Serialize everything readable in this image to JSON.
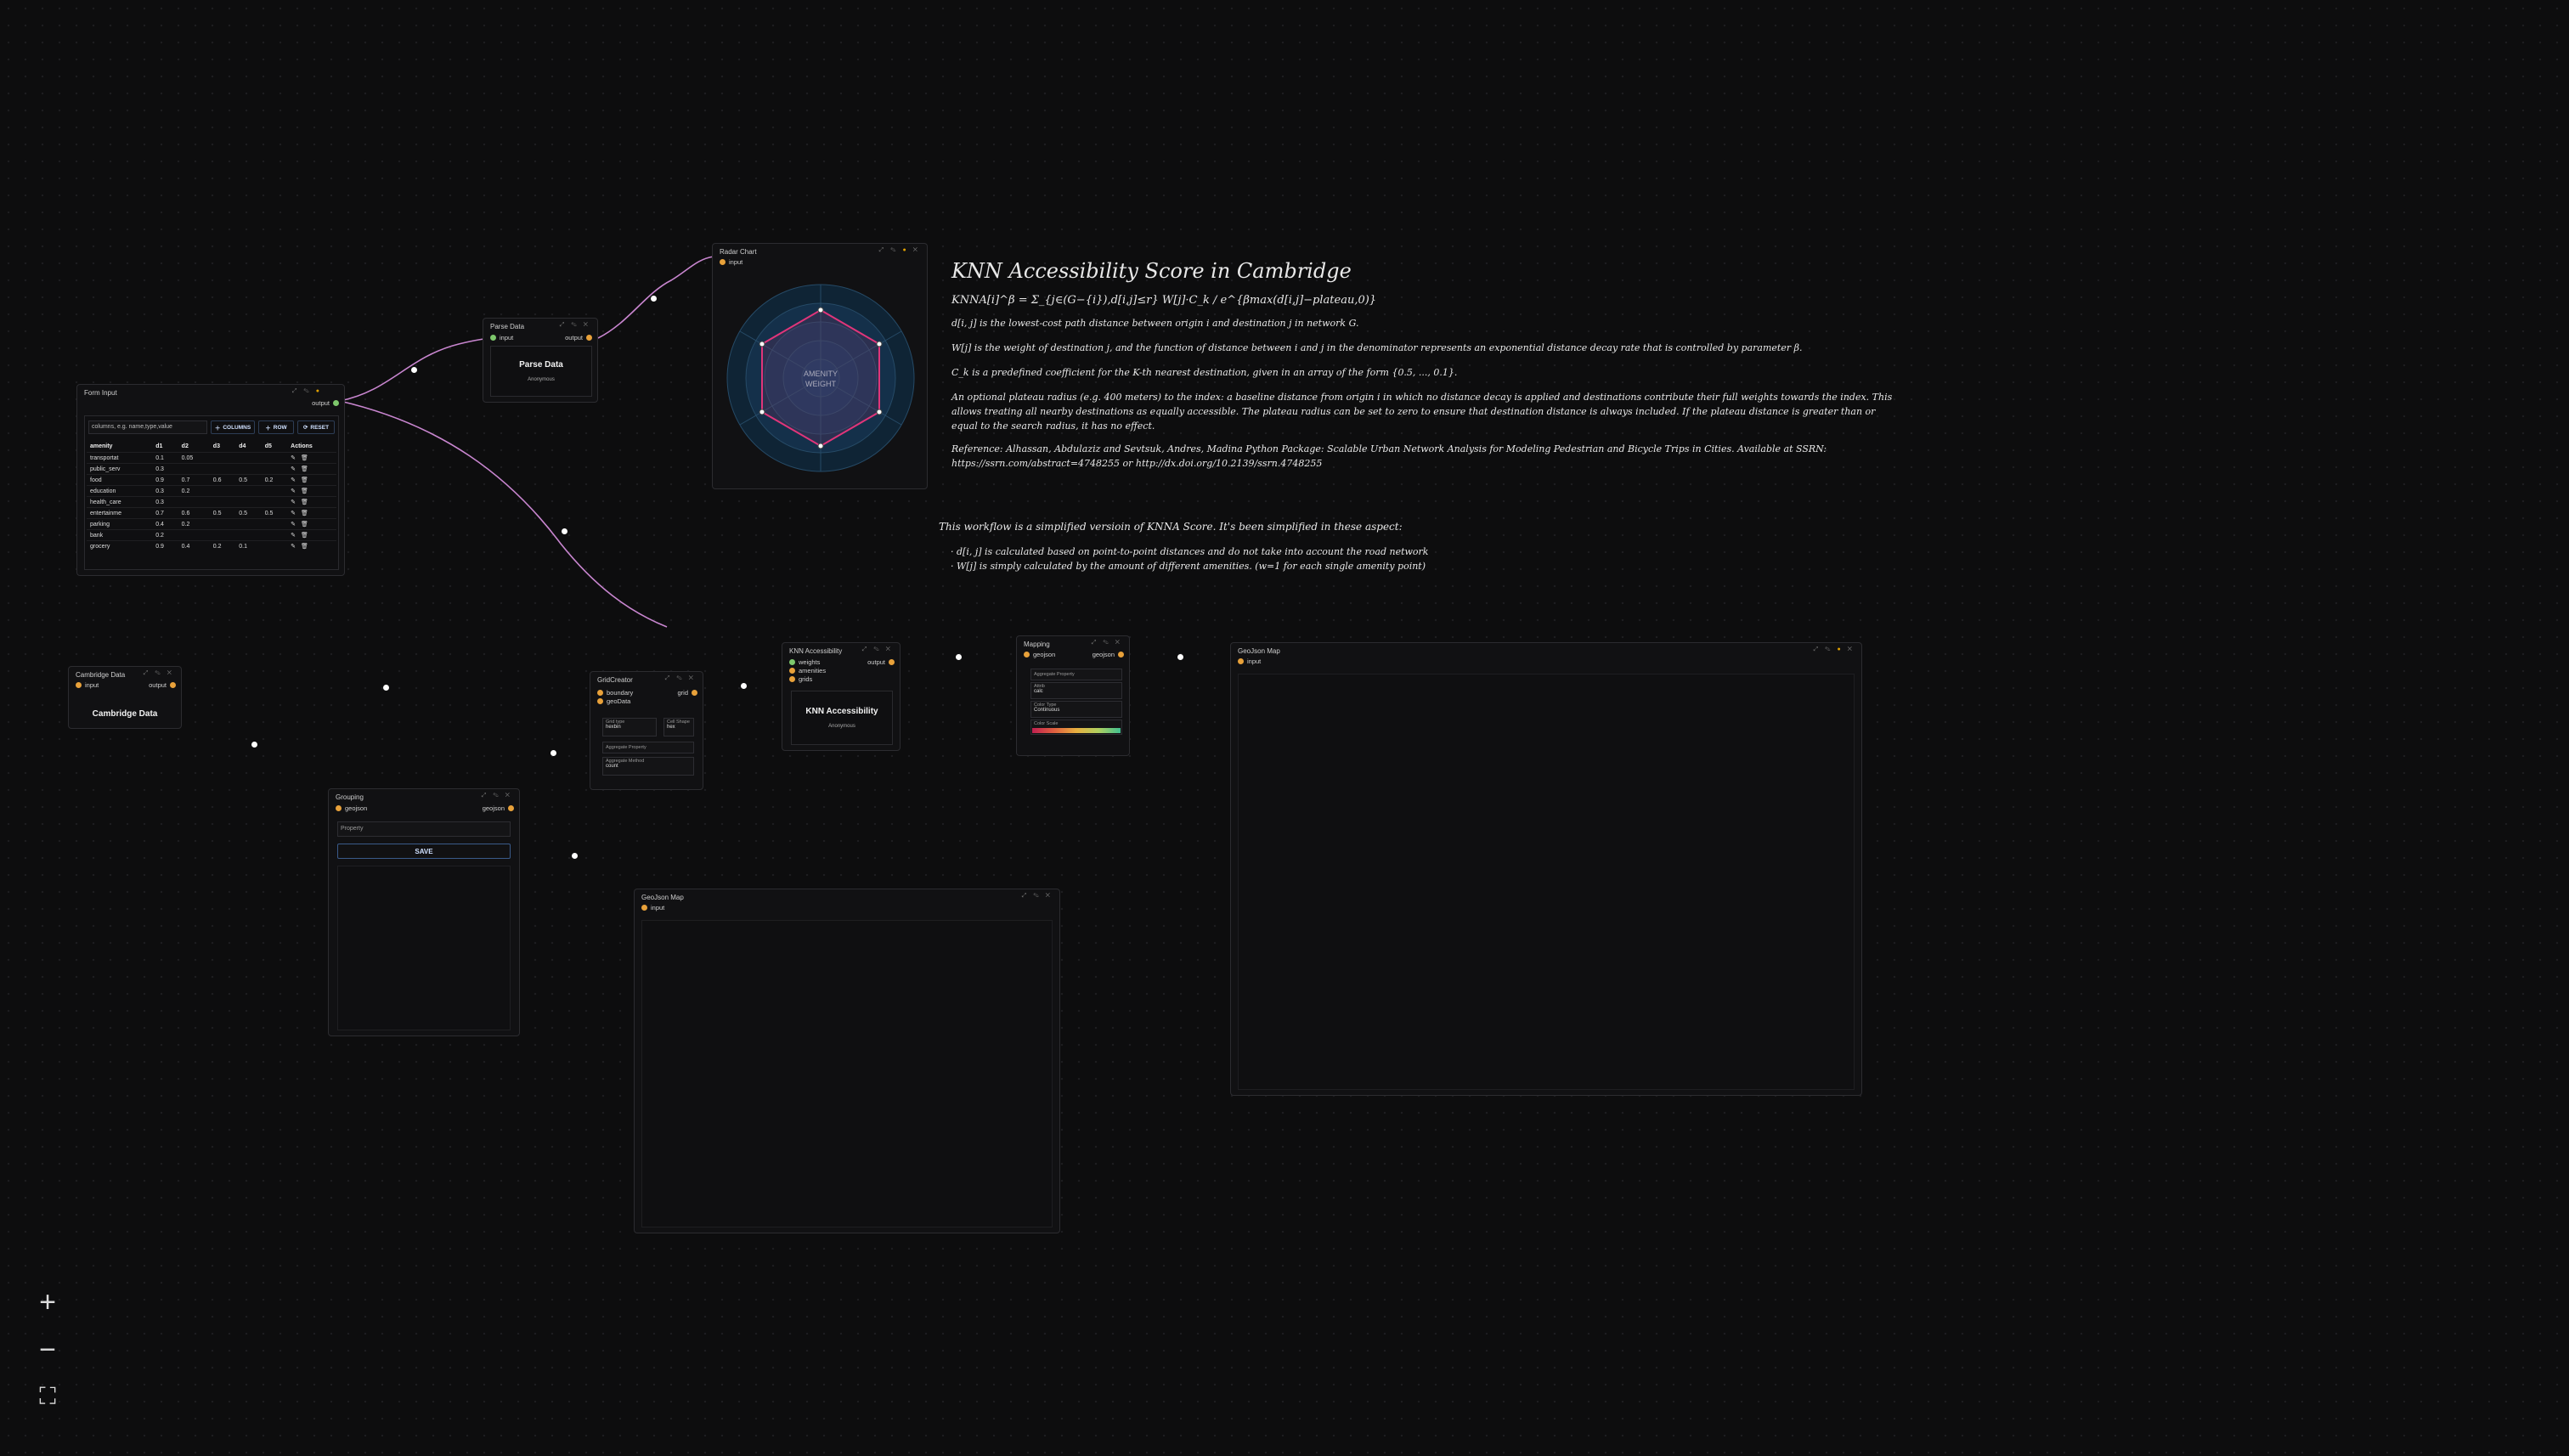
{
  "nodes": {
    "form_input": {
      "title": "Form Input",
      "out_port": "output",
      "columns_placeholder": "columns, e.g. name,type,value",
      "btn_columns": "COLUMNS",
      "btn_row": "ROW",
      "btn_reset": "RESET",
      "headers": [
        "amenity",
        "d1",
        "d2",
        "d3",
        "d4",
        "d5",
        "Actions"
      ],
      "rows": [
        [
          "transportat",
          "0.1",
          "0.05",
          "",
          "",
          ""
        ],
        [
          "public_serv",
          "0.3",
          "",
          "",
          "",
          ""
        ],
        [
          "food",
          "0.9",
          "0.7",
          "0.6",
          "0.5",
          "0.2"
        ],
        [
          "education",
          "0.3",
          "0.2",
          "",
          "",
          ""
        ],
        [
          "health_care",
          "0.3",
          "",
          "",
          "",
          ""
        ],
        [
          "entertainme",
          "0.7",
          "0.6",
          "0.5",
          "0.5",
          "0.5"
        ],
        [
          "parking",
          "0.4",
          "0.2",
          "",
          "",
          ""
        ],
        [
          "bank",
          "0.2",
          "",
          "",
          "",
          ""
        ],
        [
          "grocery",
          "0.9",
          "0.4",
          "0.2",
          "0.1",
          ""
        ]
      ]
    },
    "parse_data": {
      "title": "Parse Data",
      "in_port": "input",
      "out_port": "output",
      "label": "Parse Data",
      "sub": "Anonymous"
    },
    "radar": {
      "title": "Radar Chart",
      "in_port": "input",
      "center_line1": "AMENITY",
      "center_line2": "WEIGHT"
    },
    "cambridge": {
      "title": "Cambridge Data",
      "in_port": "input",
      "out_port": "output",
      "label": "Cambridge Data"
    },
    "grouping": {
      "title": "Grouping",
      "in_port": "geojson",
      "out_port": "geojson",
      "field_placeholder": "Property",
      "save": "SAVE"
    },
    "grid": {
      "title": "GridCreator",
      "in1": "boundary",
      "in2": "geoData",
      "out_port": "grid",
      "f1_label": "Grid type",
      "f1_val": "hexbin",
      "f2_label": "Cell Shape",
      "f2_val": "hex",
      "f3_label": "Aggregate Property",
      "f4_label": "Aggregate Method",
      "f4_val": "count"
    },
    "knn": {
      "title": "KNN Accessibility",
      "in1": "weights",
      "in2": "amenities",
      "in3": "grids",
      "out_port": "output",
      "label": "KNN Accessibility",
      "sub": "Anonymous"
    },
    "mapping": {
      "title": "Mapping",
      "in_port": "geojson",
      "out_port": "geojson",
      "f1": "Aggregate Property",
      "f2_label": "Attrib",
      "f2_val": "calc",
      "f3_label": "Color Type",
      "f3_val": "Continuous",
      "f4_label": "Color Scale"
    },
    "map1": {
      "title": "GeoJson Map",
      "in_port": "input"
    },
    "map2": {
      "title": "GeoJson Map",
      "in_port": "input"
    }
  },
  "doc": {
    "title": "KNN Accessibility Score in Cambridge",
    "formula": "KNNA[i]^β = Σ_{j∈(G−{i}),d[i,j]≤r} W[j]·C_k / e^{βmax(d[i,j]−plateau,0)}",
    "p1": "d[i, j] is the lowest-cost path distance between origin i and destination j in network G.",
    "p2": "W[j] is the weight of destination j, and the function of distance between i and j in the denominator represents an exponential distance decay rate that is controlled by parameter β.",
    "p3": "C_k is a predefined coefficient for the K-th nearest destination, given in an array of the form {0.5, ..., 0.1}.",
    "p4": "An optional plateau radius (e.g. 400 meters) to the index: a baseline distance from origin i in which no distance decay is applied and destinations contribute their full weights towards the index. This allows treating all nearby destinations as equally accessible. The plateau radius can be set to zero to ensure that destination distance is always included. If the plateau distance is greater than or equal to the search radius, it has no effect.",
    "p5": "Reference: Alhassan, Abdulaziz and Sevtsuk, Andres, Madina Python Package: Scalable Urban Network Analysis for Modeling Pedestrian and Bicycle Trips in Cities. Available at SSRN: https://ssrn.com/abstract=4748255 or http://dx.doi.org/10.2139/ssrn.4748255",
    "p6": "This workflow is a simplified versioin of KNNA Score. It's been simplified in these aspect:",
    "b1": "· d[i, j] is calculated based on point-to-point distances and do not take into account the road network",
    "b2": "· W[j] is simply calculated by the amount of different amenities. (w=1 for each single amenity point)"
  },
  "zoom": {
    "in": "+",
    "out": "−",
    "fit": "⛶"
  },
  "colors": {
    "edge": "#d28ad6",
    "radar_poly": "#e0357a",
    "port": "#e8a13a"
  }
}
